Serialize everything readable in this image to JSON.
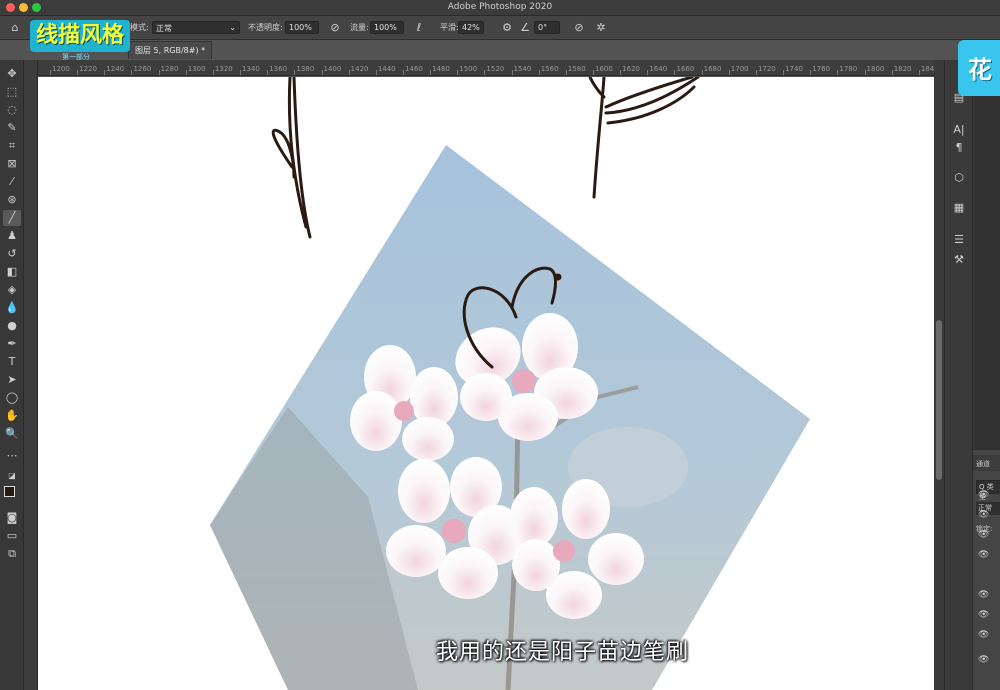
{
  "window": {
    "title": "Adobe Photoshop 2020"
  },
  "options_bar": {
    "mode_label": "模式:",
    "mode_value": "正常",
    "opacity_label": "不透明度:",
    "opacity_value": "100%",
    "flow_label": "流量:",
    "flow_value": "100%",
    "smoothing_label": "平滑:",
    "smoothing_value": "42%",
    "angle_value": "0°"
  },
  "document_tab": {
    "label": "图层 5, RGB/8#) *"
  },
  "ruler": {
    "ticks": [
      "1200",
      "1220",
      "1240",
      "1260",
      "1280",
      "1300",
      "1320",
      "1340",
      "1360",
      "1380",
      "1400",
      "1420",
      "1440",
      "1460",
      "1480",
      "1500",
      "1520",
      "1540",
      "1560",
      "1580",
      "1600",
      "1620",
      "1640",
      "1660",
      "1680",
      "1700",
      "1720",
      "1740",
      "1760",
      "1780",
      "1800",
      "1820",
      "1840"
    ]
  },
  "overlay": {
    "title_left": "线描风格",
    "title_left_sub": "第一部分",
    "title_right": "花",
    "subtitle": "我用的还是阳子苗边笔刷"
  },
  "layers_panel": {
    "tab_label": "通道",
    "search_label": "Q 类型",
    "blend_mode": "正常",
    "lock_label": "锁定:"
  },
  "colors": {
    "accent_badge": "#20b3cf",
    "badge_text": "#f4ff3a",
    "photo_sky": "#a9c3da",
    "stroke": "#2a1a12"
  }
}
